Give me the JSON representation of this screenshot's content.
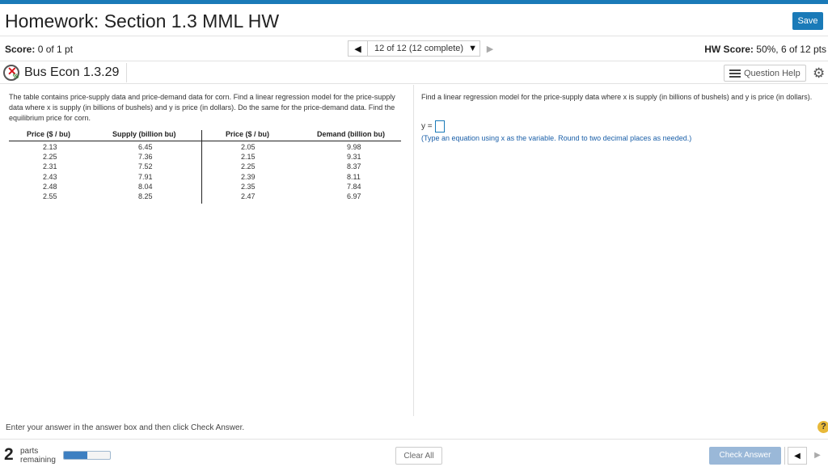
{
  "header": {
    "title": "Homework: Section 1.3 MML HW",
    "save_label": "Save"
  },
  "scorebar": {
    "score_label": "Score:",
    "score_value": "0 of 1 pt",
    "nav_select_label": "12 of 12 (12 complete)",
    "hw_score_label": "HW Score:",
    "hw_score_value": "50%, 6 of 12 pts"
  },
  "question": {
    "id_label": "Bus Econ 1.3.29",
    "status_icon_pct": "%",
    "help_label": "Question Help"
  },
  "problem": {
    "text": "The table contains price-supply data and price-demand data for corn. Find a linear regression model for the price-supply data where x is supply (in billions of bushels) and y is price (in dollars). Do the same for the price-demand data. Find the equilibrium price for corn.",
    "table": {
      "headers": [
        "Price ($ / bu)",
        "Supply (billion bu)",
        "Price ($ / bu)",
        "Demand (billion bu)"
      ],
      "supply_price": [
        "2.13",
        "2.25",
        "2.31",
        "2.43",
        "2.48",
        "2.55"
      ],
      "supply_qty": [
        "6.45",
        "7.36",
        "7.52",
        "7.91",
        "8.04",
        "8.25"
      ],
      "demand_price": [
        "2.05",
        "2.15",
        "2.25",
        "2.39",
        "2.35",
        "2.47"
      ],
      "demand_qty": [
        "9.98",
        "9.31",
        "8.37",
        "8.11",
        "7.84",
        "6.97"
      ]
    }
  },
  "answer_area": {
    "prompt": "Find a linear regression model for the price-supply data where x is supply (in billions of bushels) and y is price (in dollars).",
    "eq_prefix": "y =",
    "hint": "(Type an equation using x as the variable. Round to two decimal places as needed.)"
  },
  "footer": {
    "instructions": "Enter your answer in the answer box and then click Check Answer.",
    "help_icon": "?",
    "parts_count": "2",
    "parts_label_line1": "parts",
    "parts_label_line2": "remaining",
    "progress_fraction": 0.5,
    "clear_all_label": "Clear All",
    "check_answer_label": "Check Answer"
  },
  "icons": {
    "prev": "◀",
    "next": "▶",
    "caret": "▼",
    "gear": "⚙"
  },
  "colors": {
    "accent": "#1a7ab8",
    "incorrect": "#d6161c",
    "check_answer_disabled": "#9ab8d8"
  }
}
